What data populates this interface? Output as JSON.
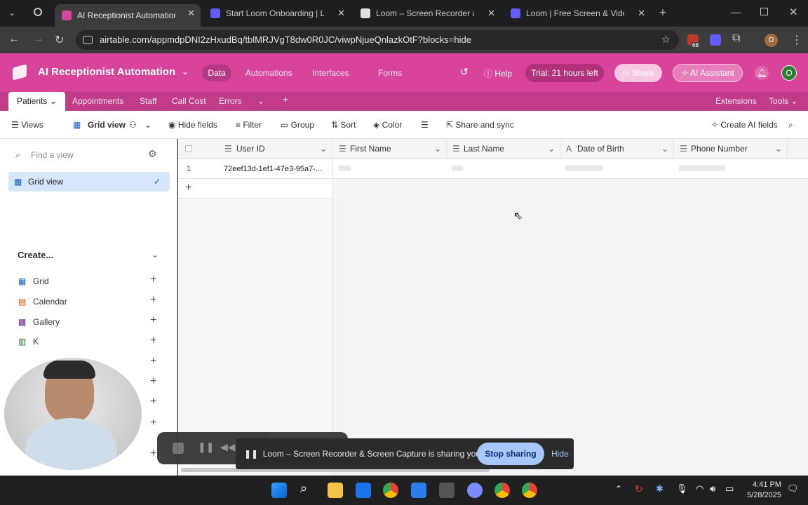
{
  "browser": {
    "tabs": [
      {
        "title": "AI Receptionist Automation",
        "active": true
      },
      {
        "title": "Start Loom Onboarding | Loom",
        "active": false
      },
      {
        "title": "Loom – Screen Recorder & Scre",
        "active": false
      },
      {
        "title": "Loom | Free Screen & Video Re",
        "active": false
      }
    ],
    "url": "airtable.com/appmdpDNI2zHxudBq/tblMRJVgT8dw0R0JC/viwpNjueQnlazkOtF?blocks=hide",
    "extension_badge": "68"
  },
  "app": {
    "base_name": "AI Receptionist Automation",
    "nav": {
      "data": "Data",
      "automations": "Automations",
      "interfaces": "Interfaces",
      "forms": "Forms"
    },
    "help": "Help",
    "trial": "Trial: 21 hours left",
    "share": "Share",
    "ai_assistant": "AI Assistant",
    "avatar": "O",
    "accent": "#d7449a"
  },
  "tables": {
    "items": [
      "Patients",
      "Appointments",
      "Staff",
      "Call Cost",
      "Errors"
    ],
    "extensions": "Extensions",
    "tools": "Tools"
  },
  "viewbar": {
    "views": "Views",
    "grid_view": "Grid view",
    "hide_fields": "Hide fields",
    "filter": "Filter",
    "group": "Group",
    "sort": "Sort",
    "color": "Color",
    "share_sync": "Share and sync",
    "create_ai": "Create AI fields"
  },
  "sidebar": {
    "find_placeholder": "Find a view",
    "selected_view": "Grid view",
    "create": "Create...",
    "create_items": [
      "Grid",
      "Calendar",
      "Gallery",
      "K"
    ]
  },
  "grid": {
    "columns": [
      "User ID",
      "First Name",
      "Last Name",
      "Date of Birth",
      "Phone Number"
    ],
    "rows": [
      {
        "num": "1",
        "user_id": "72eef13d-1ef1-47e3-95a7-..."
      }
    ]
  },
  "loom": {
    "share_text": "Loom – Screen Recorder & Screen Capture is sharing your screen.",
    "stop": "Stop sharing",
    "hide": "Hide"
  },
  "taskbar": {
    "time": "4:41 PM",
    "date": "5/28/2025"
  }
}
